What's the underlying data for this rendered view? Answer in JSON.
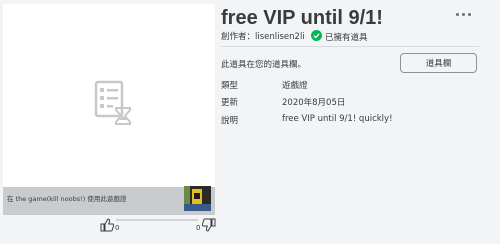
{
  "item": {
    "title": "free VIP until 9/1!",
    "creator_label": "創作者：",
    "creator_name": "lisenlisen2li",
    "owned_text": "已擁有道具",
    "inventory_notice": "此道具在您的道具欄。",
    "inventory_button": "道具欄"
  },
  "details": [
    {
      "label": "類型",
      "value": "遊戲證"
    },
    {
      "label": "更新",
      "value": "2020年8月05日"
    },
    {
      "label": "說明",
      "value": "free VIP until 9/1! quickly!"
    }
  ],
  "game_strip": {
    "text": "在 the game(kill noobs!) 使用此遊戲證"
  },
  "votes": {
    "up": "0",
    "down": "0",
    "up_fraction": 0
  },
  "icons": {
    "placeholder": "item-placeholder-icon",
    "owned": "check-circle-icon",
    "more": "more-dots-icon",
    "thumbs_up": "thumbs-up-icon",
    "thumbs_down": "thumbs-down-icon"
  },
  "colors": {
    "owned_check": "#02b757",
    "background": "#f2f4f5"
  }
}
